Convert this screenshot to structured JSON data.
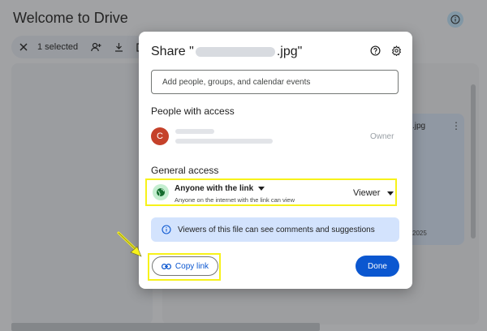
{
  "background": {
    "title": "Welcome to Drive",
    "toolbar": {
      "selected_label": "1 selected"
    },
    "card": {
      "name_suffix": ".jpg",
      "date": "2025"
    }
  },
  "dialog": {
    "title_prefix": "Share \"",
    "title_suffix": ".jpg\"",
    "add_people_placeholder": "Add people, groups, and calendar events",
    "people_with_access_heading": "People with access",
    "person": {
      "avatar_letter": "C",
      "role": "Owner"
    },
    "general_access_heading": "General access",
    "general_access": {
      "setting": "Anyone with the link",
      "description": "Anyone on the internet with the link can view",
      "role": "Viewer"
    },
    "info_banner": "Viewers of this file can see comments and suggestions",
    "copy_link_label": "Copy link",
    "done_label": "Done"
  },
  "colors": {
    "accent": "#0b57d0",
    "highlight": "#f7f21a",
    "avatar": "#c5412a",
    "banner": "#d3e3fd"
  },
  "icons": [
    "info-icon",
    "close-icon",
    "add-person-icon",
    "download-icon",
    "move-icon",
    "help-icon",
    "gear-icon",
    "globe-icon",
    "dropdown-icon",
    "link-icon",
    "more-vert-icon",
    "arrow-pointer"
  ]
}
